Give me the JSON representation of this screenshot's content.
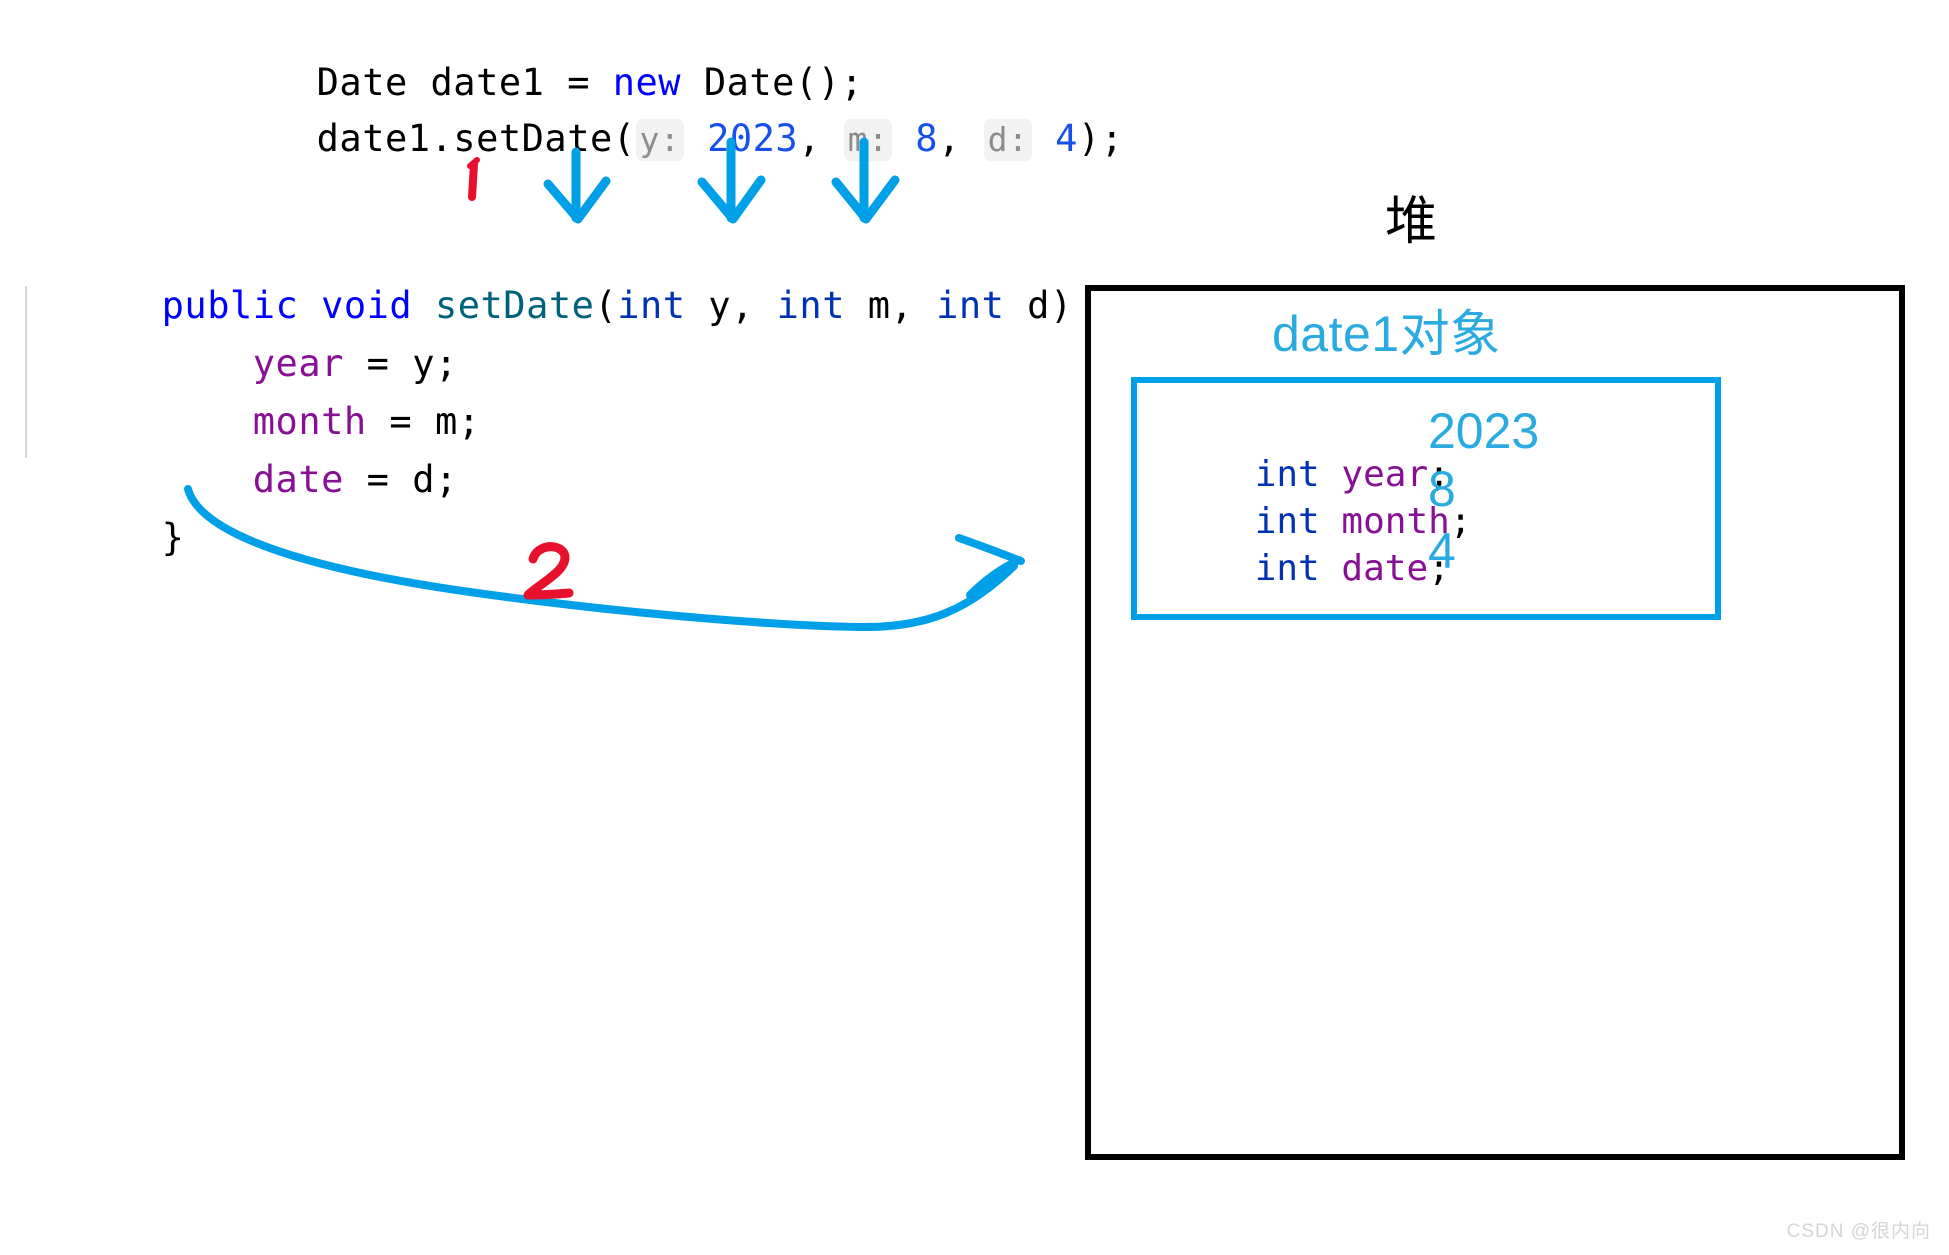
{
  "code": {
    "lines": [
      {
        "id": "line-new-date",
        "text": "Date date1 = new Date();",
        "tokens": [
          {
            "t": "Date date1 = ",
            "c": "plain"
          },
          {
            "t": "new",
            "c": "kw"
          },
          {
            "t": " Date();",
            "c": "plain"
          }
        ]
      },
      {
        "id": "line-setdate-call",
        "text": "date1.setDate( y: 2023, m: 8, d: 4);",
        "tokens": [
          {
            "t": "date1.setDate(",
            "c": "plain"
          },
          {
            "t": "y:",
            "c": "hint"
          },
          {
            "t": " ",
            "c": "plain"
          },
          {
            "t": "2023",
            "c": "num"
          },
          {
            "t": ", ",
            "c": "plain"
          },
          {
            "t": "m:",
            "c": "hint"
          },
          {
            "t": " ",
            "c": "plain"
          },
          {
            "t": "8",
            "c": "num"
          },
          {
            "t": ", ",
            "c": "plain"
          },
          {
            "t": "d:",
            "c": "hint"
          },
          {
            "t": " ",
            "c": "plain"
          },
          {
            "t": "4",
            "c": "num"
          },
          {
            "t": ");",
            "c": "plain"
          }
        ]
      },
      {
        "id": "line-method-signature",
        "text": "public void setDate(int y, int m, int d) {",
        "tokens": [
          {
            "t": "public void",
            "c": "kw"
          },
          {
            "t": " ",
            "c": "plain"
          },
          {
            "t": "setDate",
            "c": "method"
          },
          {
            "t": "(",
            "c": "plain"
          },
          {
            "t": "int",
            "c": "type"
          },
          {
            "t": " y, ",
            "c": "plain"
          },
          {
            "t": "int",
            "c": "type"
          },
          {
            "t": " m, ",
            "c": "plain"
          },
          {
            "t": "int",
            "c": "type"
          },
          {
            "t": " d) {",
            "c": "plain"
          }
        ]
      },
      {
        "id": "line-assign-year",
        "text": "    year = y;",
        "tokens": [
          {
            "t": "    ",
            "c": "plain"
          },
          {
            "t": "year",
            "c": "field"
          },
          {
            "t": " = y;",
            "c": "plain"
          }
        ]
      },
      {
        "id": "line-assign-month",
        "text": "    month = m;",
        "tokens": [
          {
            "t": "    ",
            "c": "plain"
          },
          {
            "t": "month",
            "c": "field"
          },
          {
            "t": " = m;",
            "c": "plain"
          }
        ]
      },
      {
        "id": "line-assign-date",
        "text": "    date = d;",
        "tokens": [
          {
            "t": "    ",
            "c": "plain"
          },
          {
            "t": "date",
            "c": "field"
          },
          {
            "t": " = d;",
            "c": "plain"
          }
        ]
      },
      {
        "id": "line-close-brace",
        "text": "}",
        "tokens": [
          {
            "t": "}",
            "c": "plain"
          }
        ]
      }
    ]
  },
  "annotations": {
    "step1_label": "1",
    "step2_label": "2",
    "marker_color": "#e8112d",
    "arrow_color": "#00a0e9",
    "down_arrows": [
      {
        "name": "arrow-to-param-y",
        "source": "2023",
        "target": "y"
      },
      {
        "name": "arrow-to-param-m",
        "source": "8",
        "target": "m"
      },
      {
        "name": "arrow-to-param-d",
        "source": "4",
        "target": "d"
      }
    ],
    "curve_arrow": {
      "name": "arrow-method-to-heap",
      "from": "setDate body",
      "to": "date1 object"
    }
  },
  "heap": {
    "label": "堆",
    "object_title": "date1对象",
    "border_color": "#000000",
    "object_border_color": "#00a0e9",
    "value_color": "#29abe2",
    "fields": [
      {
        "declaration": "int year;",
        "type": "int",
        "name": "year",
        "value": "2023"
      },
      {
        "declaration": "int month;",
        "type": "int",
        "name": "month",
        "value": "8"
      },
      {
        "declaration": "int date;",
        "type": "int",
        "name": "date",
        "value": "4"
      }
    ]
  },
  "watermark": {
    "text": "CSDN @很内向"
  }
}
